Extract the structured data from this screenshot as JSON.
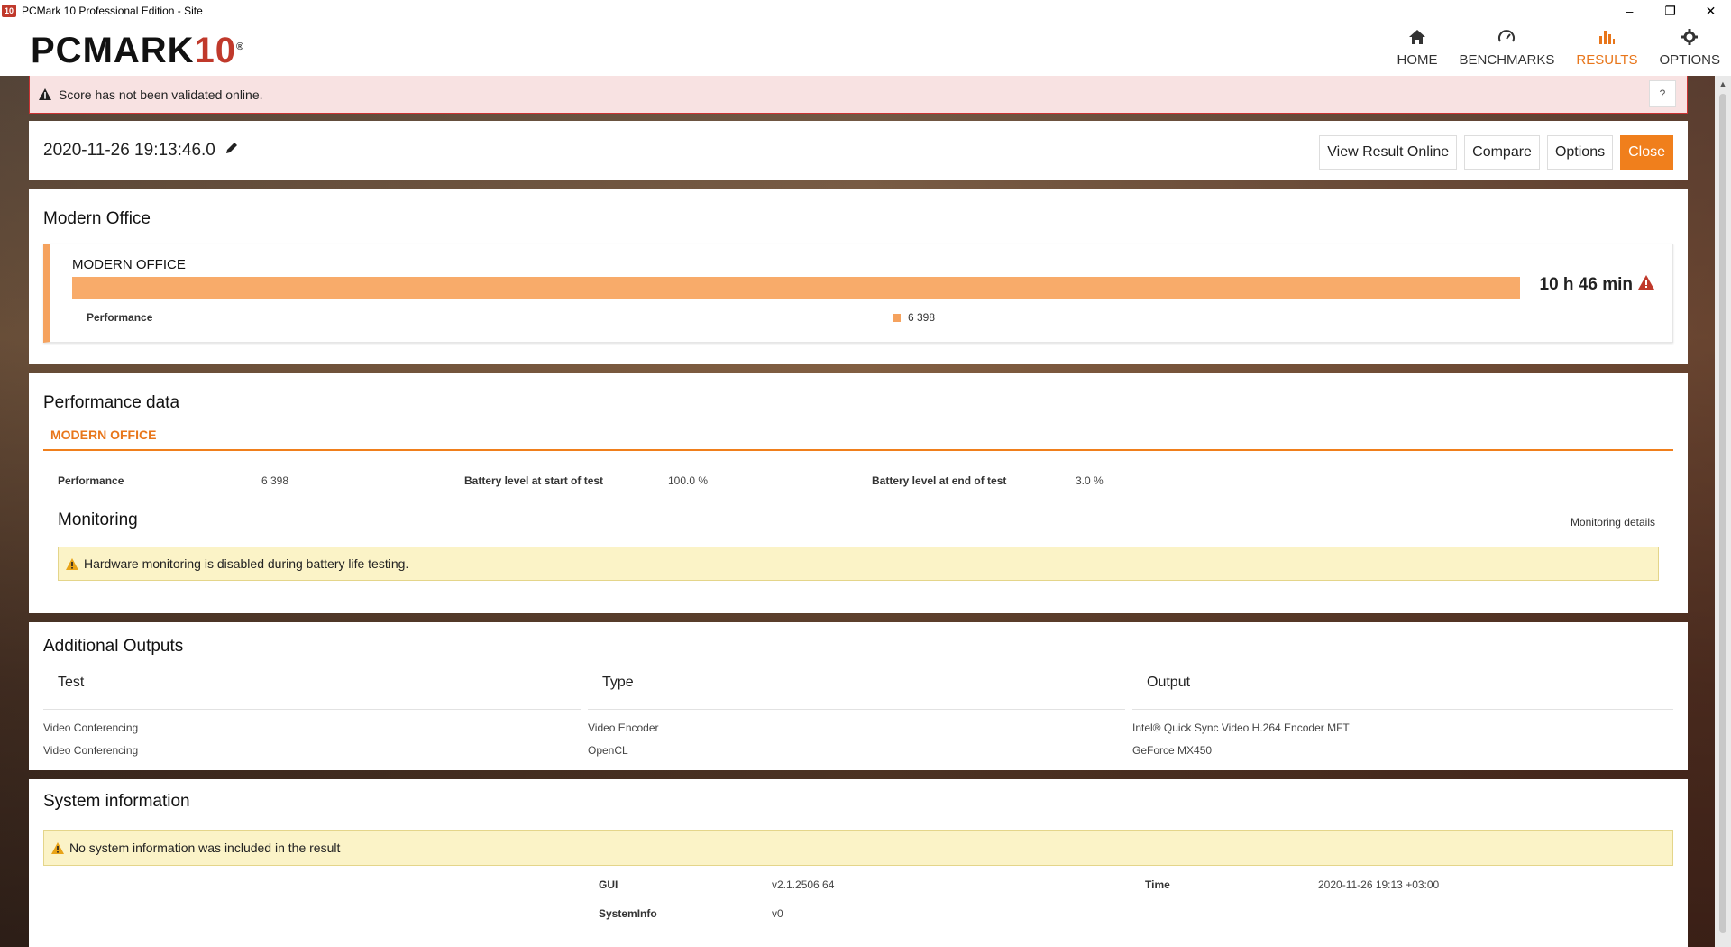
{
  "window": {
    "title": "PCMark 10 Professional Edition - Site",
    "app_icon_text": "10",
    "controls": [
      "–",
      "❐",
      "✕"
    ]
  },
  "header": {
    "logo_main": "PCMARK",
    "logo_num": "10",
    "logo_reg": "®",
    "nav": [
      {
        "label": "HOME",
        "icon": "home-icon",
        "active": false
      },
      {
        "label": "BENCHMARKS",
        "icon": "gauge-icon",
        "active": false
      },
      {
        "label": "RESULTS",
        "icon": "bar-chart-icon",
        "active": true
      },
      {
        "label": "OPTIONS",
        "icon": "gear-icon",
        "active": false
      }
    ]
  },
  "alert": {
    "text": "Score has not been validated online.",
    "help": "?"
  },
  "result": {
    "date": "2020-11-26 19:13:46.0",
    "buttons": {
      "view_online": "View Result Online",
      "compare": "Compare",
      "options": "Options",
      "close": "Close"
    }
  },
  "modern_office": {
    "section_title": "Modern Office",
    "card_title": "MODERN OFFICE",
    "score": "10 h 46 min",
    "performance_label": "Performance",
    "performance_value": "6 398"
  },
  "performance_data": {
    "title": "Performance data",
    "tab": "MODERN OFFICE",
    "items": [
      {
        "label": "Performance",
        "value": "6 398"
      },
      {
        "label": "Battery level at start of test",
        "value": "100.0 %"
      },
      {
        "label": "Battery level at end of test",
        "value": "3.0 %"
      }
    ],
    "monitoring_title": "Monitoring",
    "monitoring_link": "Monitoring details",
    "monitoring_notice": "Hardware monitoring is disabled during battery life testing."
  },
  "additional_outputs": {
    "title": "Additional Outputs",
    "headers": [
      "Test",
      "Type",
      "Output"
    ],
    "rows": [
      [
        "Video Conferencing",
        "Video Encoder",
        "Intel® Quick Sync Video H.264 Encoder MFT"
      ],
      [
        "Video Conferencing",
        "OpenCL",
        "GeForce MX450"
      ]
    ]
  },
  "system_information": {
    "title": "System information",
    "notice": "No system information was included in the result",
    "gui_label": "GUI",
    "gui_value": "v2.1.2506 64",
    "time_label": "Time",
    "time_value": "2020-11-26 19:13 +03:00",
    "sysinfo_label": "SystemInfo",
    "sysinfo_value": "v0"
  },
  "colors": {
    "accent": "#f07f1c",
    "bar": "#f8ab6a",
    "alert_bg": "#f8e2e2",
    "notice_bg": "#fbf3c7"
  }
}
